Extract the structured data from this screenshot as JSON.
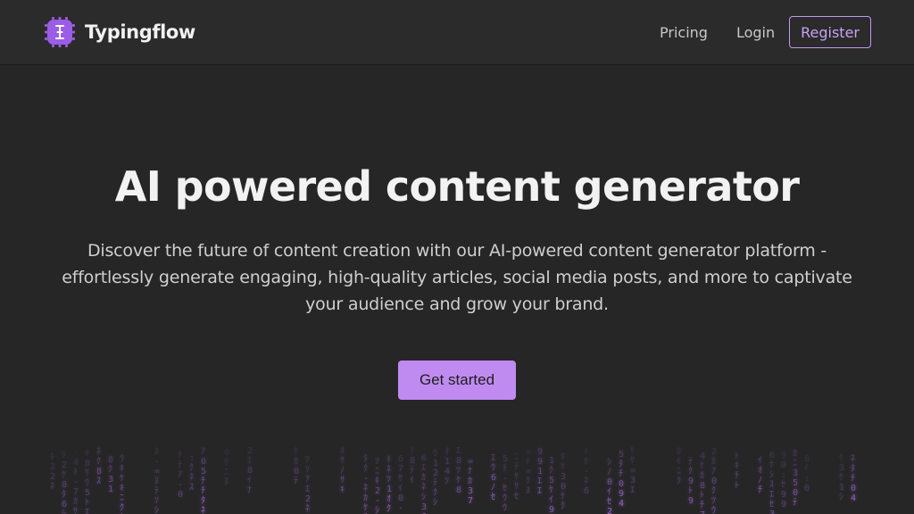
{
  "brand": {
    "name": "Typingflow",
    "logo_icon": "cursor-chip-logo",
    "accent": "#9b5de5"
  },
  "nav": {
    "pricing": "Pricing",
    "login": "Login",
    "register": "Register"
  },
  "hero": {
    "title": "AI powered content generator",
    "subtitle": "Discover the future of content creation with our AI-powered content generator platform - effortlessly generate engaging, high-quality articles, social media posts, and more to captivate your audience and grow your brand.",
    "cta": "Get started"
  },
  "colors": {
    "background": "#262626",
    "header": "#2b2b2b",
    "primary": "#c08bf0",
    "matrix": "#a56de0"
  }
}
